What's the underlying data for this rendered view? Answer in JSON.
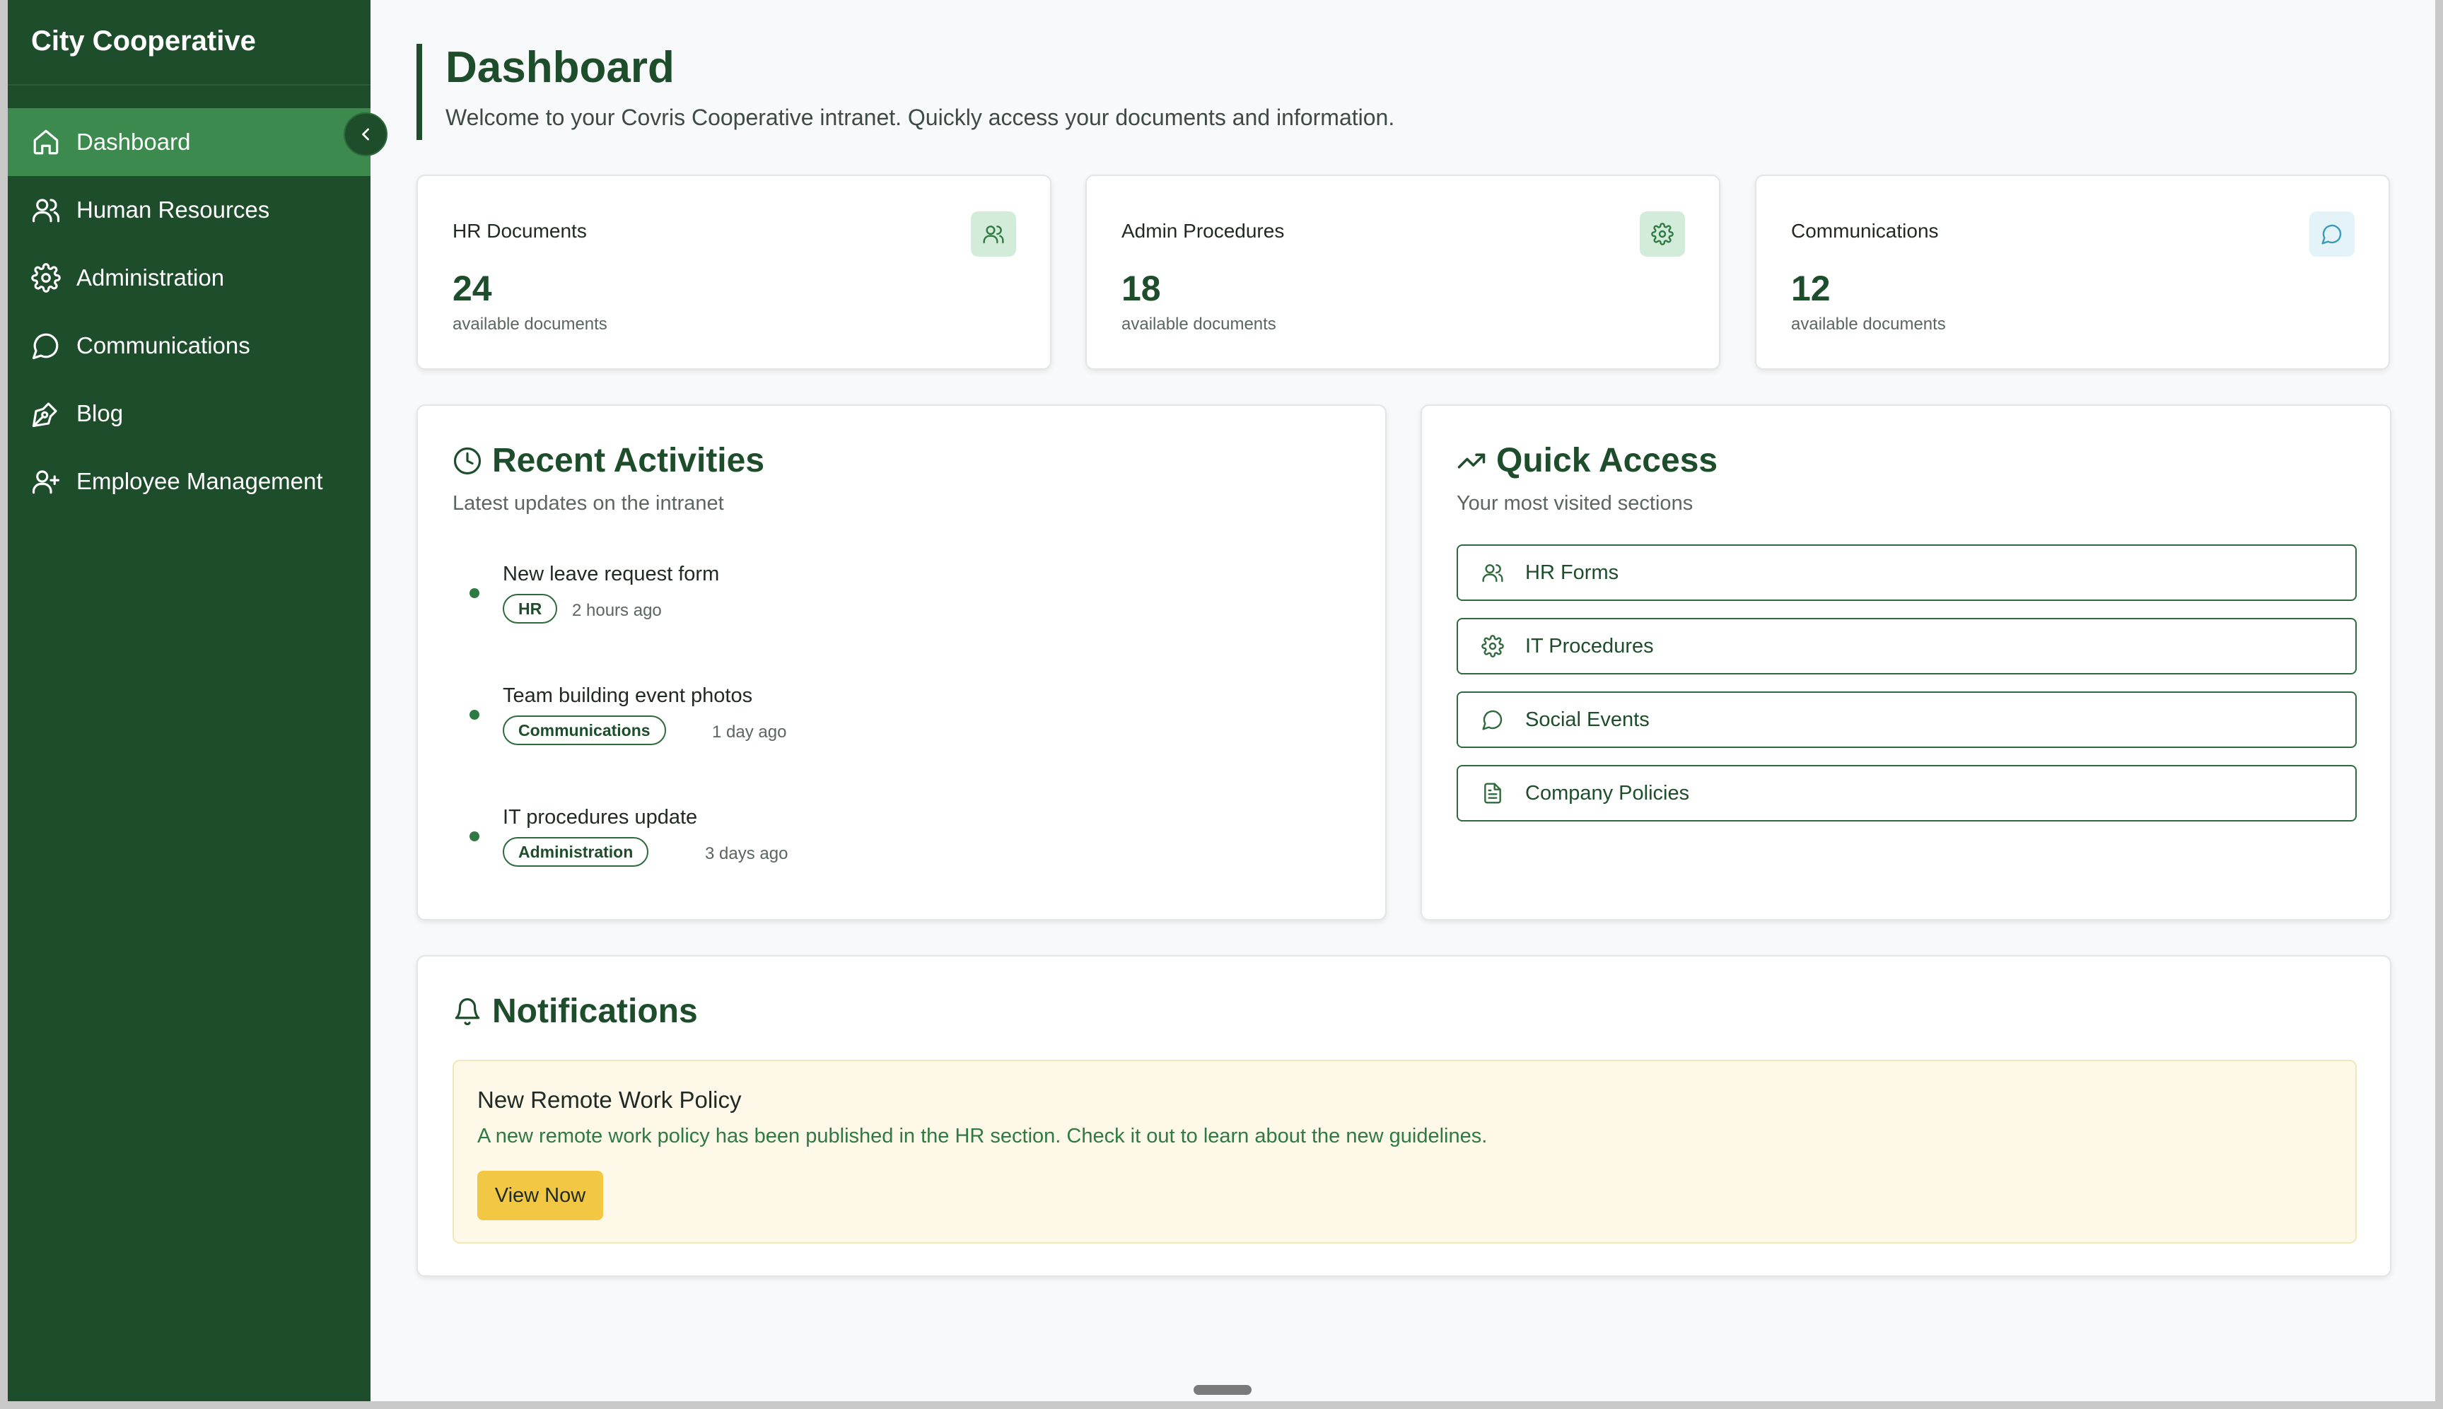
{
  "sidebar": {
    "brand": "City Cooperative",
    "items": [
      {
        "label": "Dashboard",
        "icon": "home-icon"
      },
      {
        "label": "Human Resources",
        "icon": "users-icon"
      },
      {
        "label": "Administration",
        "icon": "gear-icon"
      },
      {
        "label": "Communications",
        "icon": "chat-icon"
      },
      {
        "label": "Blog",
        "icon": "pen-icon"
      },
      {
        "label": "Employee Management",
        "icon": "user-plus-icon"
      }
    ]
  },
  "header": {
    "title": "Dashboard",
    "subtitle": "Welcome to your Covris Cooperative intranet. Quickly access your documents and information."
  },
  "stats": [
    {
      "label": "HR Documents",
      "value": "24",
      "caption": "available documents",
      "icon": "users-icon"
    },
    {
      "label": "Admin Procedures",
      "value": "18",
      "caption": "available documents",
      "icon": "gear-icon"
    },
    {
      "label": "Communications",
      "value": "12",
      "caption": "available documents",
      "icon": "chat-icon"
    }
  ],
  "recent": {
    "title": "Recent Activities",
    "subtitle": "Latest updates on the intranet",
    "items": [
      {
        "title": "New leave request form",
        "tag": "HR",
        "time": "2 hours ago"
      },
      {
        "title": "Team building event photos",
        "tag": "Communications",
        "time": "1 day ago"
      },
      {
        "title": "IT procedures update",
        "tag": "Administration",
        "time": "3 days ago"
      }
    ]
  },
  "quick": {
    "title": "Quick Access",
    "subtitle": "Your most visited sections",
    "items": [
      {
        "label": "HR Forms",
        "icon": "users-icon"
      },
      {
        "label": "IT Procedures",
        "icon": "gear-icon"
      },
      {
        "label": "Social Events",
        "icon": "chat-icon"
      },
      {
        "label": "Company Policies",
        "icon": "document-icon"
      }
    ]
  },
  "notifications": {
    "title": "Notifications",
    "notice": {
      "title": "New Remote Work Policy",
      "text": "A new remote work policy has been published in the HR section. Check it out to learn about the new guidelines.",
      "button": "View Now"
    }
  },
  "colors": {
    "sidebar": "#1e4d2b",
    "active": "#3c8a4e",
    "accent": "#1e4d2b",
    "button_yellow": "#f2c744"
  }
}
